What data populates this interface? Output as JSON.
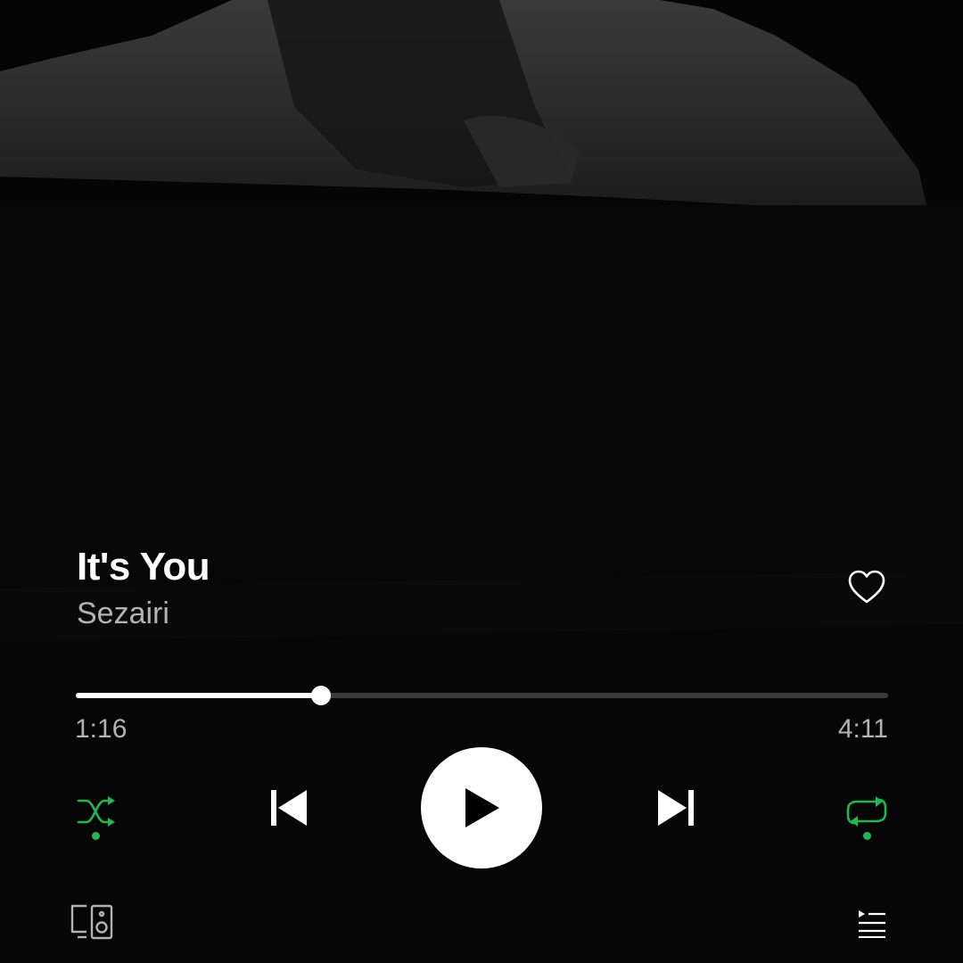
{
  "track": {
    "title": "It's You",
    "artist": "Sezairi",
    "liked": false
  },
  "playback": {
    "elapsed": "1:16",
    "total": "4:11",
    "progress_fraction": 0.302,
    "is_playing": false,
    "shuffle_enabled": true,
    "repeat_enabled": true
  },
  "icons": {
    "like": "heart-outline-icon",
    "shuffle": "shuffle-icon",
    "previous": "skip-previous-icon",
    "play": "play-icon",
    "next": "skip-next-icon",
    "repeat": "repeat-icon",
    "devices": "devices-icon",
    "queue": "queue-icon"
  },
  "colors": {
    "accent": "#1db954",
    "primary_text": "#ffffff",
    "secondary_text": "#b3b3b3",
    "background": "#040404"
  }
}
